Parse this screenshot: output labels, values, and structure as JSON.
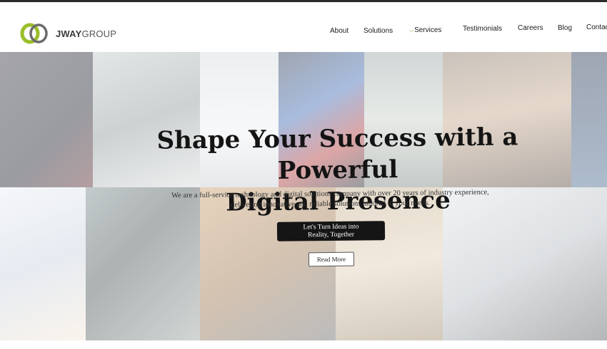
{
  "logo": {
    "brand_strong": "JWAY",
    "brand_light": "GROUP",
    "icon": "jway-rings-logo",
    "colors": {
      "green": "#9bbf2a",
      "gray": "#6b6b6b"
    }
  },
  "nav": {
    "about": "About",
    "solutions": "Solutions",
    "services_chevron": "chevron-down-icon",
    "services": "Services",
    "testimonials": "Testimonials",
    "careers": "Careers",
    "blog": "Blog",
    "contact": "Contac"
  },
  "hero": {
    "title_line1": "Shape Your Success with a Powerful",
    "title_line2": "Digital Presence",
    "subtitle_line1": "We are a full-service technology and digital solutions company with over 20 years of industry experience,",
    "subtitle_line2": "delivering innovative and reliable solutions tailored to your needs.",
    "cta_label": "Let's Turn Ideas into Reality, Together",
    "read_more_label": "Read More",
    "background": "collage of workplace technology photos"
  },
  "colors": {
    "accent": "#9bbf2a",
    "text": "#141414",
    "cta_bg": "#151515"
  }
}
